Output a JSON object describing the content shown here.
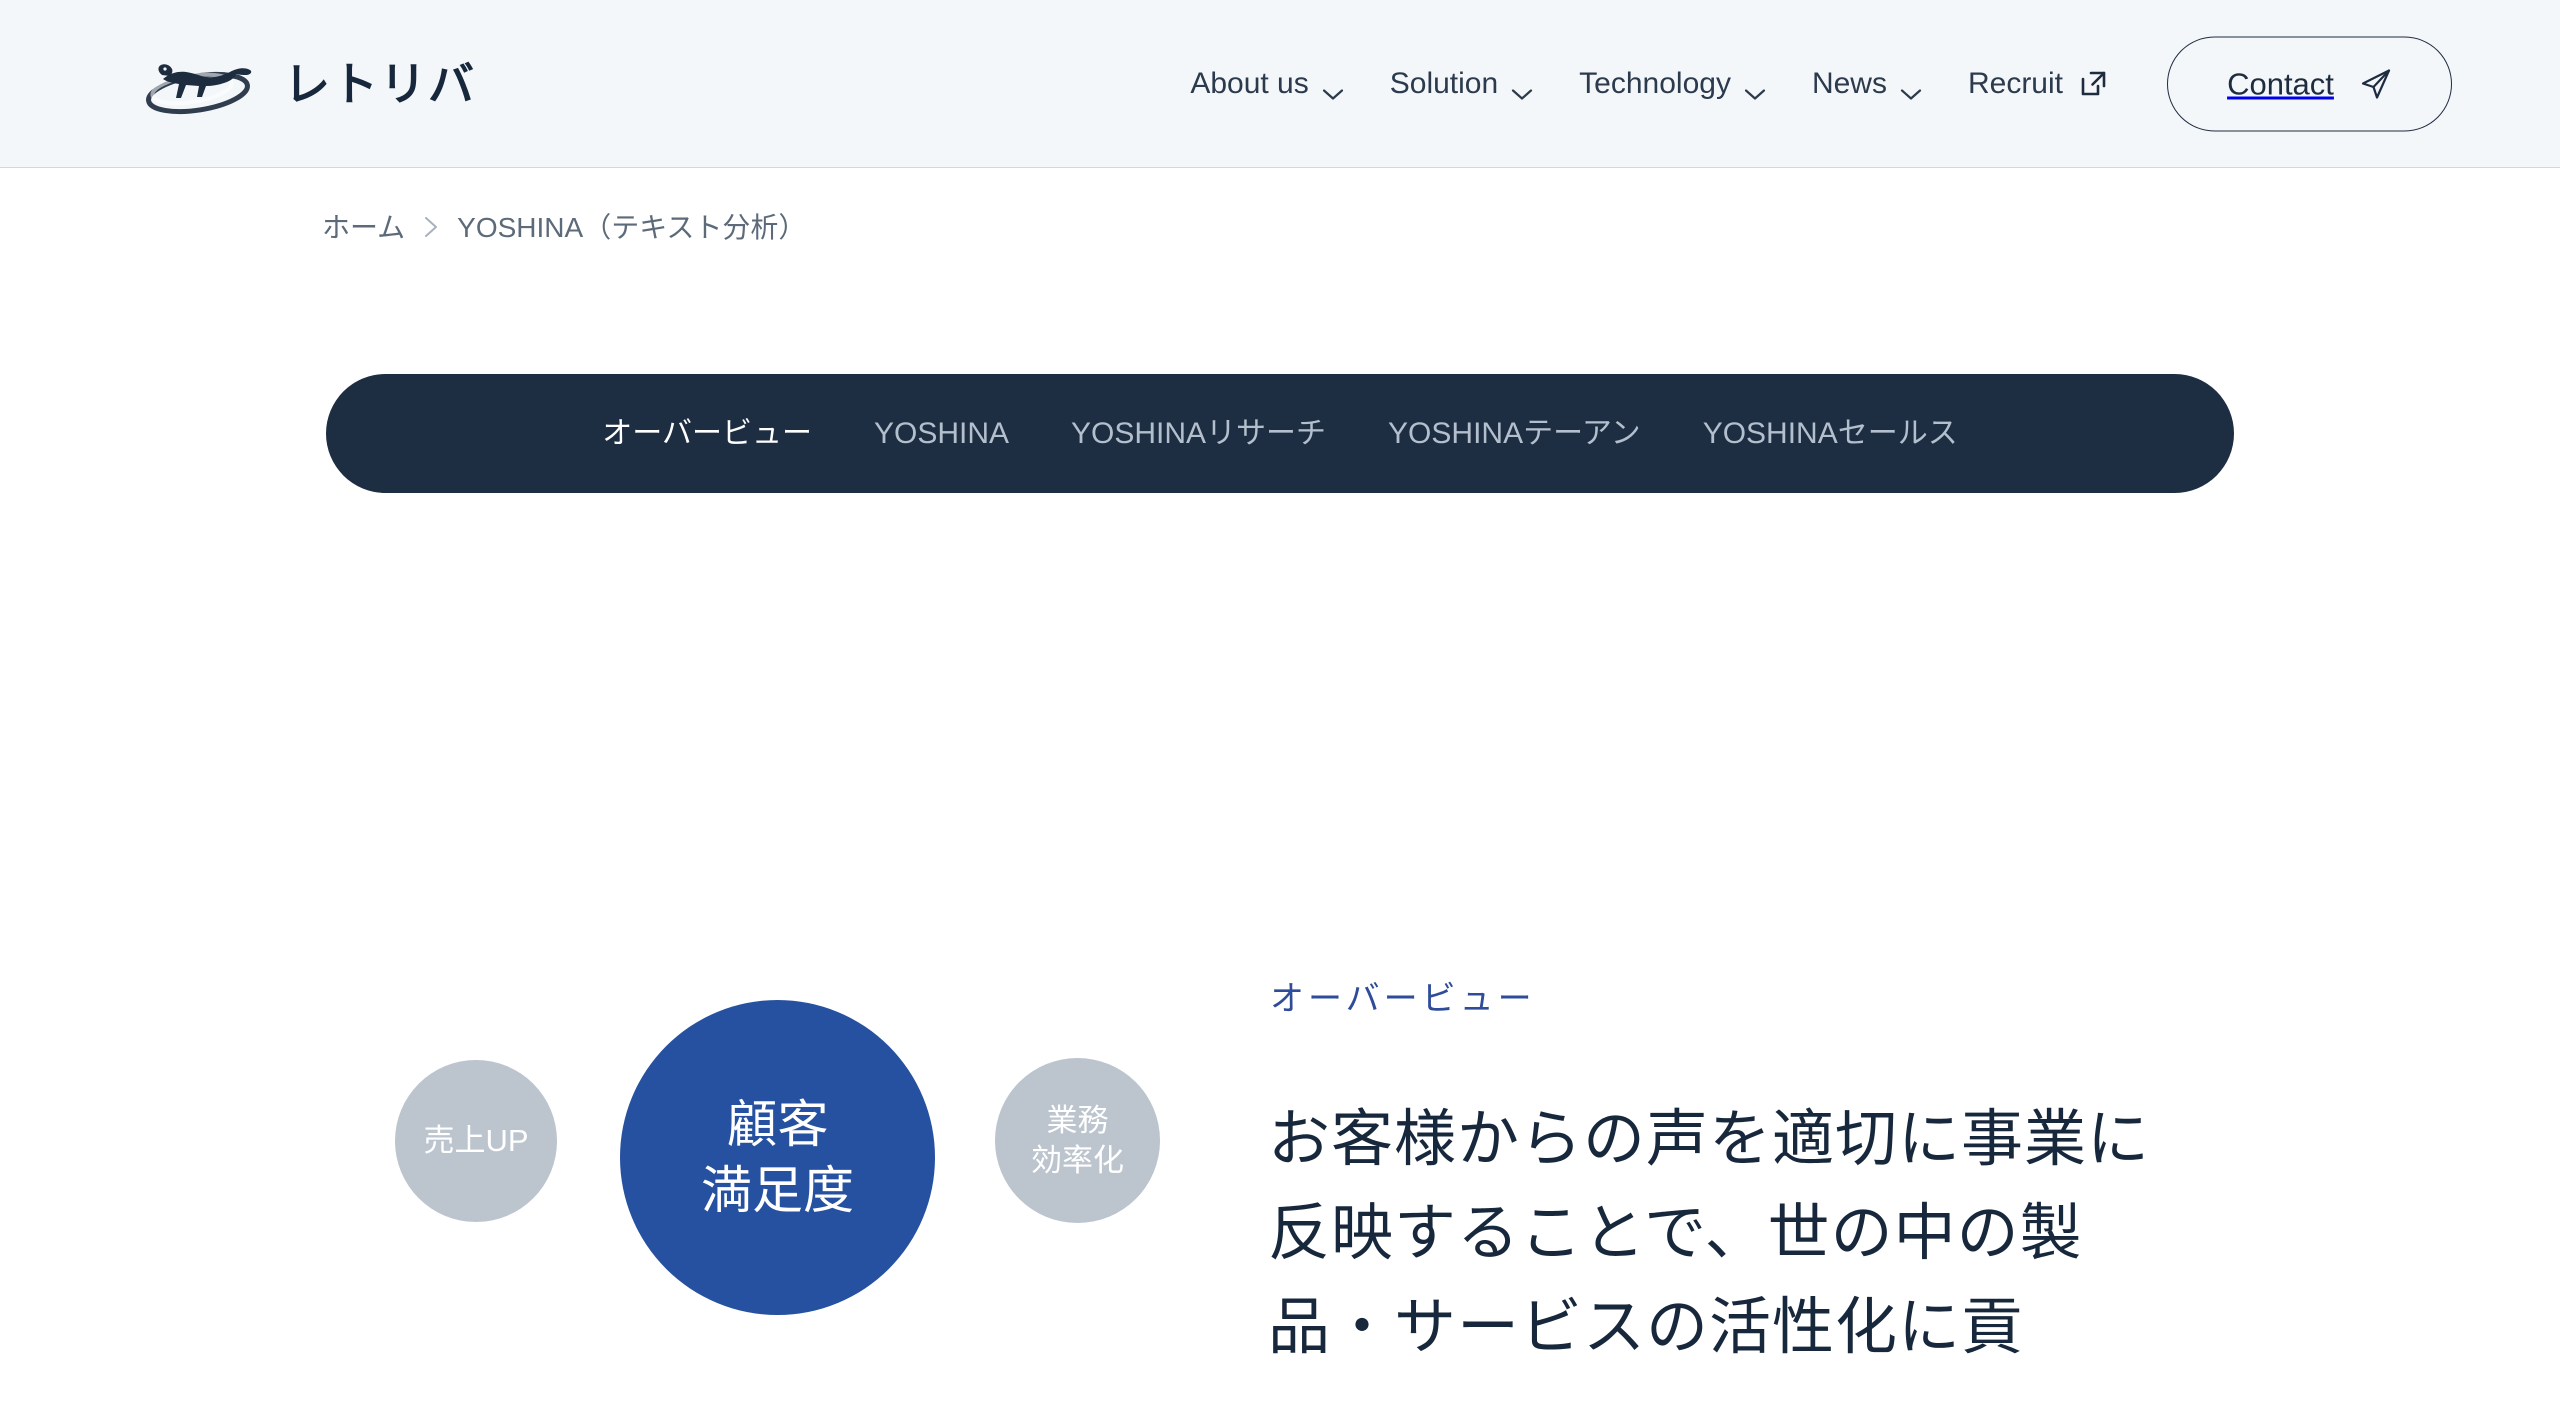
{
  "header": {
    "brand": {
      "name": "レトリバ",
      "logo_icon": "retriever-dog-orbit-logo"
    },
    "nav": [
      {
        "label": "About us",
        "icon": "chevron-down-icon"
      },
      {
        "label": "Solution",
        "icon": "chevron-down-icon"
      },
      {
        "label": "Technology",
        "icon": "chevron-down-icon"
      },
      {
        "label": "News",
        "icon": "chevron-down-icon"
      },
      {
        "label": "Recruit",
        "icon": "external-link-icon"
      }
    ],
    "contact": {
      "label": "Contact",
      "icon": "paper-plane-icon"
    },
    "background_color": "#F4F7FA",
    "text_color": "#2B3A4C"
  },
  "breadcrumb": {
    "separator_icon": "chevron-right-icon",
    "items": [
      {
        "label": "ホーム"
      },
      {
        "label": "YOSHINA（テキスト分析）"
      }
    ]
  },
  "tabbar": {
    "background_color": "#1D2E43",
    "active_color": "#FFFFFF",
    "inactive_color": "#B3BFCD",
    "tabs": [
      {
        "label": "オーバービュー",
        "active": true
      },
      {
        "label": "YOSHINA",
        "active": false
      },
      {
        "label": "YOSHINAリサーチ",
        "active": false
      },
      {
        "label": "YOSHINAテーアン",
        "active": false
      },
      {
        "label": "YOSHINAセールス",
        "active": false
      }
    ]
  },
  "overview": {
    "eyebrow": "オーバービュー",
    "eyebrow_color": "#2F4C9B",
    "heading": "お客様からの声を適切に事業に反映することで、世の中の製品・サービスの活性化に貢",
    "heading_color": "#18283C",
    "diagram": {
      "accent_color": "#2551A0",
      "muted_color": "#BCC4CE",
      "circles": [
        {
          "label": "売上UP",
          "emphasis": "muted"
        },
        {
          "label": "顧客\n満足度",
          "emphasis": "accent"
        },
        {
          "label": "業務\n効率化",
          "emphasis": "muted"
        }
      ]
    }
  }
}
